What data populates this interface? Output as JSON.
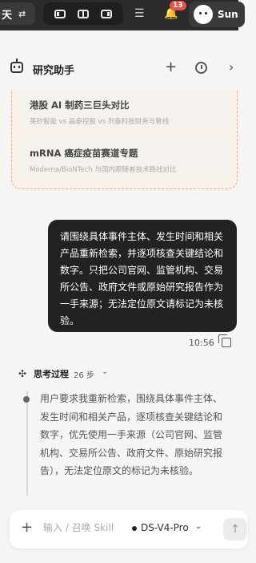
{
  "topbar": {
    "left_label": "天",
    "notification_count": "13",
    "user_name": "Sun"
  },
  "panel": {
    "title": "研究助手"
  },
  "suggestions": [
    {
      "title": "港股 AI 制药三巨头对比",
      "subtitle": "英矽智能 vs 晶泰控股 vs 剂泰科技财务与管线"
    },
    {
      "title": "mRNA 癌症疫苗赛道专题",
      "subtitle": "Moderna/BioNTech 与国内跟随者技术路线对比"
    }
  ],
  "message": {
    "text": "请围绕具体事件主体、发生时间和相关产品重新检索，并逐项核查关键结论和数字。只把公司官网、监管机构、交易所公告、政府文件或原始研究报告作为一手来源；无法定位原文请标记为未核验。",
    "time": "10:56"
  },
  "thinking": {
    "title": "思考过程",
    "steps": "26 步",
    "text": "用户要求我重新检索，围绕具体事件主体、发生时间和相关产品，逐项核查关键结论和数字，优先使用一手来源（公司官网、监管机构、交易所公告、政府文件、原始研究报告），无法定位原文的标记为未核验。"
  },
  "composer": {
    "placeholder": "输入 / 召唤 Skill",
    "model": "DS-V4-Pro"
  }
}
